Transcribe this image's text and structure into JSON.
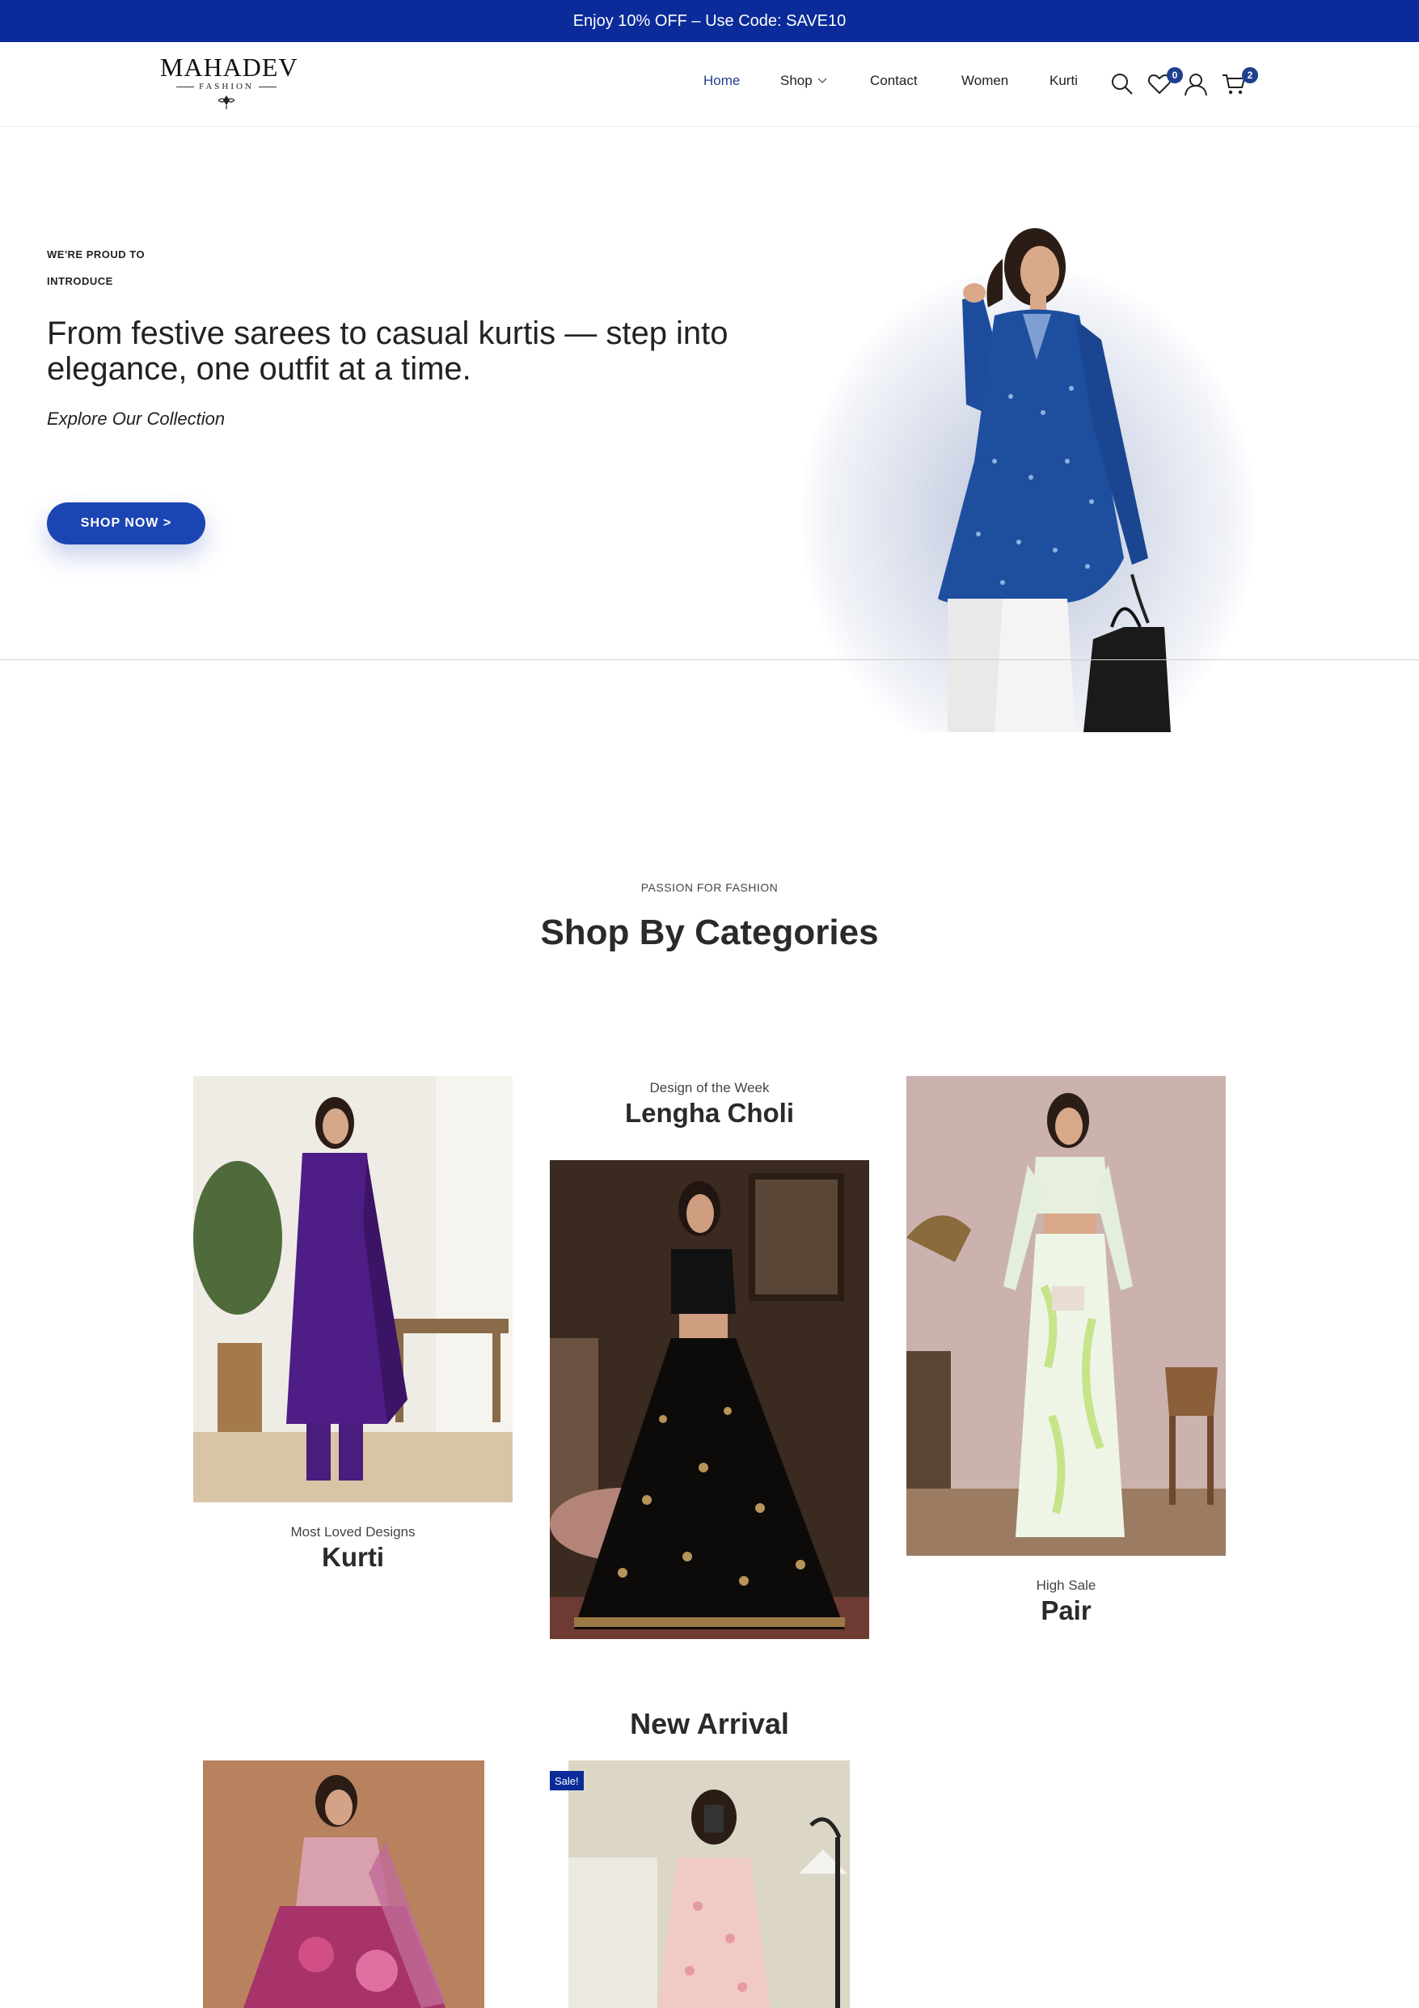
{
  "announcement": "Enjoy 10% OFF – Use Code: SAVE10",
  "brand": {
    "name": "MAHADEV",
    "tagline": "FASHION"
  },
  "nav": {
    "home": "Home",
    "shop": "Shop",
    "contact": "Contact",
    "women": "Women",
    "kurti": "Kurti"
  },
  "header_icons": [
    "search-icon",
    "heart-icon",
    "user-icon",
    "cart-icon"
  ],
  "counts": {
    "wishlist": "0",
    "cart": "2"
  },
  "hero": {
    "eyebrow": "WE'RE PROUD TO INTRODUCE",
    "title": "From festive sarees to casual kurtis — step into elegance, one outfit at a time.",
    "subtitle": "Explore Our Collection",
    "cta": "SHOP NOW >"
  },
  "categories": {
    "eyebrow": "PASSION FOR FASHION",
    "title": "Shop By Categories",
    "items": [
      {
        "small": "Most Loved Designs",
        "name": "Kurti"
      },
      {
        "small": "Design of the Week",
        "name": "Lengha Choli"
      },
      {
        "small": "High Sale",
        "name": "Pair"
      }
    ]
  },
  "new_arrival": {
    "title": "New Arrival",
    "sale_badge": "Sale!"
  },
  "colors": {
    "brand_blue": "#0a2b99",
    "button_blue": "#1b45b3",
    "accent_nav": "#1f3f8f"
  }
}
